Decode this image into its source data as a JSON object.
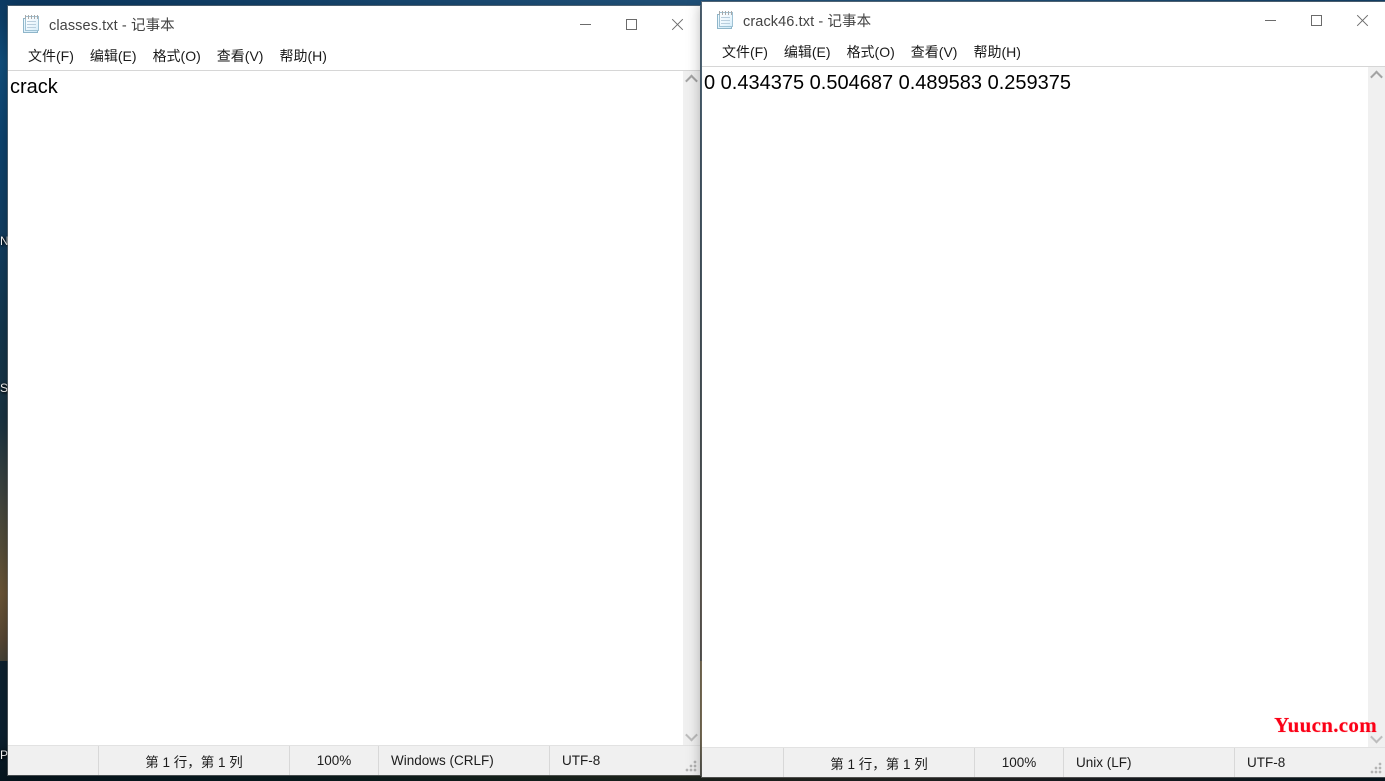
{
  "desktop": {
    "visible_icon_labels": [
      "N",
      "St",
      "P"
    ],
    "background_colors": {
      "top": "#0c3a63",
      "mid": "#14384f",
      "bottom": "#b5813e"
    }
  },
  "watermark": {
    "text": "Yuucn.com",
    "color": "#fb0017"
  },
  "windows": [
    {
      "id": "left",
      "title": "classes.txt - 记事本",
      "app_icon": "notepad-icon",
      "menu": [
        {
          "label": "文件(F)",
          "name": "menu-file"
        },
        {
          "label": "编辑(E)",
          "name": "menu-edit"
        },
        {
          "label": "格式(O)",
          "name": "menu-format"
        },
        {
          "label": "查看(V)",
          "name": "menu-view"
        },
        {
          "label": "帮助(H)",
          "name": "menu-help"
        }
      ],
      "content": "crack",
      "window_controls": {
        "minimize": "minimize-icon",
        "maximize": "maximize-icon",
        "close": "close-icon"
      },
      "scrollbar": {
        "up_arrow": "chevron-up-icon",
        "down_arrow": "chevron-down-icon"
      },
      "status": {
        "cursor_position": "第 1 行，第 1 列",
        "zoom": "100%",
        "line_ending": "Windows (CRLF)",
        "encoding": "UTF-8"
      }
    },
    {
      "id": "right",
      "title": "crack46.txt - 记事本",
      "app_icon": "notepad-icon",
      "menu": [
        {
          "label": "文件(F)",
          "name": "menu-file"
        },
        {
          "label": "编辑(E)",
          "name": "menu-edit"
        },
        {
          "label": "格式(O)",
          "name": "menu-format"
        },
        {
          "label": "查看(V)",
          "name": "menu-view"
        },
        {
          "label": "帮助(H)",
          "name": "menu-help"
        }
      ],
      "content": "0 0.434375 0.504687 0.489583 0.259375",
      "window_controls": {
        "minimize": "minimize-icon",
        "maximize": "maximize-icon",
        "close": "close-icon"
      },
      "scrollbar": {
        "up_arrow": "chevron-up-icon",
        "down_arrow": "chevron-down-icon"
      },
      "status": {
        "cursor_position": "第 1 行，第 1 列",
        "zoom": "100%",
        "line_ending": "Unix (LF)",
        "encoding": "UTF-8"
      }
    }
  ]
}
